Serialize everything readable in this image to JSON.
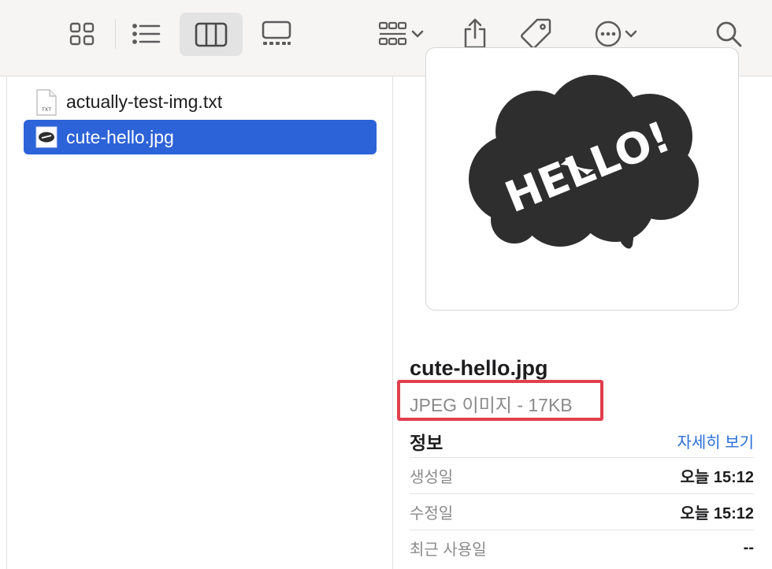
{
  "toolbar": {
    "buttons": [
      {
        "name": "icon-view-button",
        "icon": "grid-icon"
      },
      {
        "name": "list-view-button",
        "icon": "list-icon"
      },
      {
        "name": "column-view-button",
        "icon": "columns-icon",
        "active": true
      },
      {
        "name": "gallery-view-button",
        "icon": "gallery-icon"
      },
      {
        "name": "group-by-button",
        "icon": "group-grid-icon"
      },
      {
        "name": "share-button",
        "icon": "share-icon"
      },
      {
        "name": "tags-button",
        "icon": "tag-icon"
      },
      {
        "name": "more-actions-button",
        "icon": "ellipsis-circle-icon"
      },
      {
        "name": "search-button",
        "icon": "search-icon"
      }
    ]
  },
  "files": [
    {
      "name": "actually-test-img.txt",
      "icon": "txt-file-icon",
      "icon_label": "TXT",
      "selected": false
    },
    {
      "name": "cute-hello.jpg",
      "icon": "jpg-thumbnail-icon",
      "selected": true
    }
  ],
  "preview": {
    "image_text": "HELLO!",
    "file_name": "cute-hello.jpg",
    "kind": "JPEG 이미지 - 17KB"
  },
  "info": {
    "heading": "정보",
    "more_link": "자세히 보기",
    "rows": [
      {
        "label": "생성일",
        "value": "오늘 15:12"
      },
      {
        "label": "수정일",
        "value": "오늘 15:12"
      },
      {
        "label": "최근 사용일",
        "value": "--"
      }
    ]
  },
  "colors": {
    "selection": "#2d63d8",
    "highlight_box": "#e0404d",
    "link": "#2a6fd6",
    "cloud": "#2e2e2e"
  }
}
